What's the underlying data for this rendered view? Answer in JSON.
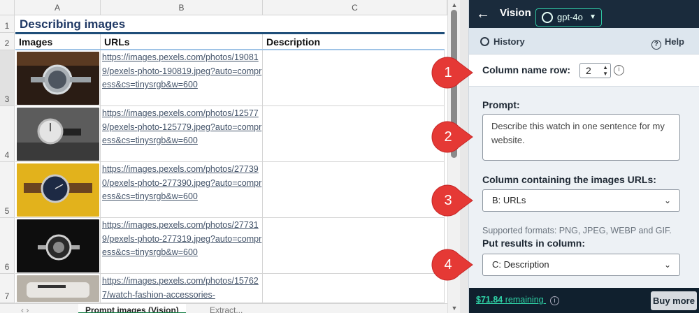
{
  "sheet": {
    "columns": [
      "A",
      "B",
      "C"
    ],
    "rows": [
      "1",
      "2",
      "3",
      "4",
      "5",
      "6",
      "7"
    ],
    "title": "Describing images",
    "headers": [
      "Images",
      "URLs",
      "Description"
    ],
    "urls": [
      "https://images.pexels.com/photos/190819/pexels-photo-190819.jpeg?auto=compress&cs=tinysrgb&w=600",
      "https://images.pexels.com/photos/125779/pexels-photo-125779.jpeg?auto=compress&cs=tinysrgb&w=600",
      "https://images.pexels.com/photos/277390/pexels-photo-277390.jpeg?auto=compress&cs=tinysrgb&w=600",
      "https://images.pexels.com/photos/277319/pexels-photo-277319.jpeg?auto=compress&cs=tinysrgb&w=600",
      "https://images.pexels.com/photos/157627/watch-fashion-accessories-"
    ],
    "tabs": [
      "Prompt images (Vision)",
      "Extract..."
    ]
  },
  "panel": {
    "title": "Vision",
    "model": "gpt-4o",
    "history": "History",
    "help": "Help",
    "column_name_row_label": "Column name row:",
    "column_name_row_value": "2",
    "prompt_label": "Prompt:",
    "prompt_text": "Describe this watch in one sentence for my website.",
    "image_column_label": "Column containing the images URLs:",
    "image_column_value": "B: URLs",
    "supported_formats": "Supported formats: PNG, JPEG, WEBP and GIF.",
    "results_column_label": "Put results in column:",
    "results_column_value": "C: Description",
    "credit_amount": "$71.84",
    "credit_suffix": "remaining",
    "buy_more": "Buy more"
  },
  "callouts": [
    "1",
    "2",
    "3",
    "4"
  ],
  "colors": {
    "accent": "#2fc3a0",
    "panel_header": "#1a2b3c",
    "callout_red": "#e53935"
  }
}
